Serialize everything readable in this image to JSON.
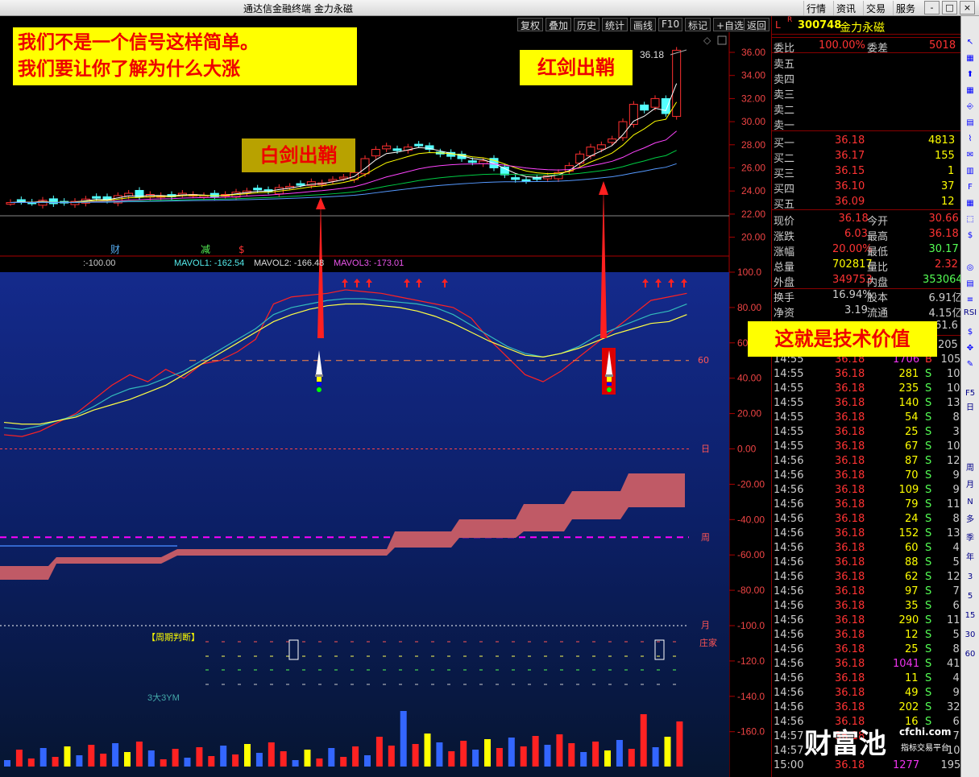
{
  "window": {
    "title": "通达信金融终端 金力永磁",
    "menus": [
      "行情",
      "资讯",
      "交易",
      "服务"
    ],
    "controls": [
      "-",
      "□",
      "×"
    ]
  },
  "toolbar": [
    "复权",
    "叠加",
    "历史",
    "统计",
    "画线",
    "F10",
    "标记",
    "+自选",
    "返回"
  ],
  "annotations": {
    "top_left_1": "我们不是一个信号这样简单。",
    "top_left_2": "我们要让你了解为什么大涨",
    "red_sword": "红剑出鞘",
    "white_sword": "白剑出鞘",
    "tech_value": "这就是技术价值"
  },
  "price_panel": {
    "high_label": "36.18",
    "yaxis": [
      "36.00",
      "34.00",
      "32.00",
      "30.00",
      "28.00",
      "26.00",
      "24.00",
      "22.00",
      "20.00"
    ],
    "markers": [
      "财",
      "减",
      "$"
    ]
  },
  "indicator": {
    "mavol_prefix": ":-100.00",
    "mavol1": "MAVOL1: -162.54",
    "mavol2": "MAVOL2: -166.48",
    "mavol3": "MAVOL3: -173.01",
    "yaxis": [
      "100.0",
      "80.00",
      "60.00",
      "40.00",
      "20.00",
      "0.00",
      "-20.00",
      "-40.00",
      "-60.00",
      "-80.00",
      "-100.0",
      "-120.0",
      "-140.0",
      "-160.0"
    ],
    "lines": {
      "l60": "60",
      "day": "日",
      "week": "周",
      "month": "月",
      "zhuang": "庄家"
    },
    "cycle_label": "【周期判断】",
    "bottom_label": "3大3YM"
  },
  "quote": {
    "code_prefix": "L",
    "code_r": "R",
    "code": "300748",
    "name": "金力永磁",
    "weibi_label": "委比",
    "weibi": "100.00%",
    "weicha_label": "委差",
    "weicha": "5018",
    "sell": [
      "卖五",
      "卖四",
      "卖三",
      "卖二",
      "卖一"
    ],
    "buy": [
      {
        "l": "买一",
        "p": "36.18",
        "v": "4813"
      },
      {
        "l": "买二",
        "p": "36.17",
        "v": "155"
      },
      {
        "l": "买三",
        "p": "36.15",
        "v": "1"
      },
      {
        "l": "买四",
        "p": "36.10",
        "v": "37"
      },
      {
        "l": "买五",
        "p": "36.09",
        "v": "12"
      }
    ],
    "stats": [
      {
        "a": "现价",
        "av": "36.18",
        "b": "今开",
        "bv": "30.66"
      },
      {
        "a": "涨跌",
        "av": "6.03",
        "b": "最高",
        "bv": "36.18"
      },
      {
        "a": "涨幅",
        "av": "20.00%",
        "b": "最低",
        "bv": "30.17"
      },
      {
        "a": "总量",
        "av": "702817",
        "b": "量比",
        "bv": "2.32"
      },
      {
        "a": "外盘",
        "av": "349753",
        "b": "内盘",
        "bv": "353064"
      },
      {
        "a": "换手",
        "av": "16.94%",
        "b": "股本",
        "bv": "6.91亿"
      },
      {
        "a": "净资",
        "av": "3.19",
        "b": "流通",
        "bv": "4.15亿"
      },
      {
        "a": "",
        "av": "",
        "b": "",
        "bv": "61.6"
      }
    ],
    "first_tick_tail": "205",
    "ticks": [
      {
        "t": "14:55",
        "p": "36.18",
        "v": "1706",
        "s": "B",
        "n": "105"
      },
      {
        "t": "14:55",
        "p": "36.18",
        "v": "281",
        "s": "S",
        "n": "10"
      },
      {
        "t": "14:55",
        "p": "36.18",
        "v": "235",
        "s": "S",
        "n": "10"
      },
      {
        "t": "14:55",
        "p": "36.18",
        "v": "140",
        "s": "S",
        "n": "13"
      },
      {
        "t": "14:55",
        "p": "36.18",
        "v": "54",
        "s": "S",
        "n": "8"
      },
      {
        "t": "14:55",
        "p": "36.18",
        "v": "25",
        "s": "S",
        "n": "3"
      },
      {
        "t": "14:55",
        "p": "36.18",
        "v": "67",
        "s": "S",
        "n": "10"
      },
      {
        "t": "14:56",
        "p": "36.18",
        "v": "87",
        "s": "S",
        "n": "12"
      },
      {
        "t": "14:56",
        "p": "36.18",
        "v": "70",
        "s": "S",
        "n": "9"
      },
      {
        "t": "14:56",
        "p": "36.18",
        "v": "109",
        "s": "S",
        "n": "9"
      },
      {
        "t": "14:56",
        "p": "36.18",
        "v": "79",
        "s": "S",
        "n": "11"
      },
      {
        "t": "14:56",
        "p": "36.18",
        "v": "24",
        "s": "S",
        "n": "8"
      },
      {
        "t": "14:56",
        "p": "36.18",
        "v": "152",
        "s": "S",
        "n": "13"
      },
      {
        "t": "14:56",
        "p": "36.18",
        "v": "60",
        "s": "S",
        "n": "4"
      },
      {
        "t": "14:56",
        "p": "36.18",
        "v": "88",
        "s": "S",
        "n": "5"
      },
      {
        "t": "14:56",
        "p": "36.18",
        "v": "62",
        "s": "S",
        "n": "12"
      },
      {
        "t": "14:56",
        "p": "36.18",
        "v": "97",
        "s": "S",
        "n": "7"
      },
      {
        "t": "14:56",
        "p": "36.18",
        "v": "35",
        "s": "S",
        "n": "6"
      },
      {
        "t": "14:56",
        "p": "36.18",
        "v": "290",
        "s": "S",
        "n": "11"
      },
      {
        "t": "14:56",
        "p": "36.18",
        "v": "12",
        "s": "S",
        "n": "5"
      },
      {
        "t": "14:56",
        "p": "36.18",
        "v": "25",
        "s": "S",
        "n": "8"
      },
      {
        "t": "14:56",
        "p": "36.18",
        "v": "1041",
        "s": "S",
        "n": "41"
      },
      {
        "t": "14:56",
        "p": "36.18",
        "v": "11",
        "s": "S",
        "n": "4"
      },
      {
        "t": "14:56",
        "p": "36.18",
        "v": "49",
        "s": "S",
        "n": "9"
      },
      {
        "t": "14:56",
        "p": "36.18",
        "v": "202",
        "s": "S",
        "n": "32"
      },
      {
        "t": "14:56",
        "p": "36.18",
        "v": "16",
        "s": "S",
        "n": "6"
      },
      {
        "t": "14:57",
        "p": "36.18",
        "v": "",
        "s": "",
        "n": "7"
      },
      {
        "t": "14:57",
        "p": "",
        "v": "",
        "s": "",
        "n": "10"
      },
      {
        "t": "15:00",
        "p": "36.18",
        "v": "1277",
        "s": "",
        "n": "195"
      }
    ]
  },
  "watermark": {
    "site": "cfchi.com",
    "brand": "财富池",
    "sub": "指标交易平台"
  },
  "iconbar": [
    "RSI",
    "F5",
    "日",
    "周",
    "月",
    "N",
    "多",
    "季",
    "年",
    "3",
    "5",
    "15",
    "30",
    "60"
  ],
  "colors": {
    "up": "#ff3030",
    "down": "#54ffff",
    "yellow": "#ffff00",
    "annotation_bg": "#ffff00"
  }
}
